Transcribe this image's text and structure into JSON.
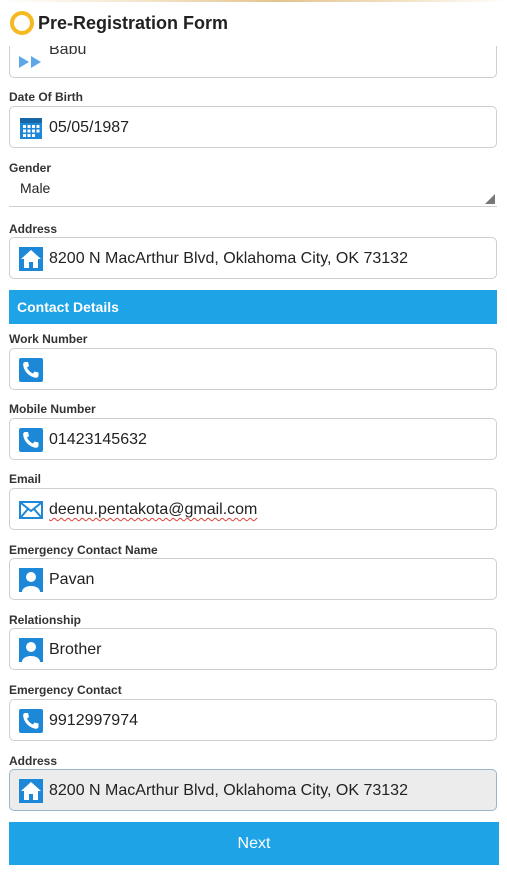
{
  "app": {
    "title": "Pre-Registration Form",
    "accent_color": "#1ea3e6",
    "logo_color": "#f5b922"
  },
  "fields": {
    "name_partial": {
      "value": "Babu",
      "icon": "flag-icon"
    },
    "dob": {
      "label": "Date Of Birth",
      "value": "05/05/1987",
      "icon": "calendar-icon"
    },
    "gender": {
      "label": "Gender",
      "value": "Male"
    },
    "address": {
      "label": "Address",
      "value": "8200 N MacArthur Blvd, Oklahoma City, OK 73132",
      "icon": "home-icon"
    }
  },
  "contact": {
    "section_title": "Contact Details",
    "work_number": {
      "label": "Work Number",
      "value": "",
      "icon": "phone-icon"
    },
    "mobile_number": {
      "label": "Mobile Number",
      "value": "01423145632",
      "icon": "phone-icon"
    },
    "email": {
      "label": "Email",
      "value": "deenu.pentakota@gmail.com",
      "icon": "mail-icon"
    },
    "emergency_name": {
      "label": "Emergency Contact Name",
      "value": "Pavan",
      "icon": "person-icon"
    },
    "relationship": {
      "label": "Relationship",
      "value": "Brother",
      "icon": "person-icon"
    },
    "emergency_contact": {
      "label": "Emergency Contact",
      "value": "9912997974",
      "icon": "phone-icon"
    },
    "address": {
      "label": "Address",
      "value": "8200 N MacArthur Blvd, Oklahoma City, OK 73132",
      "icon": "home-icon"
    }
  },
  "actions": {
    "next_label": "Next"
  }
}
